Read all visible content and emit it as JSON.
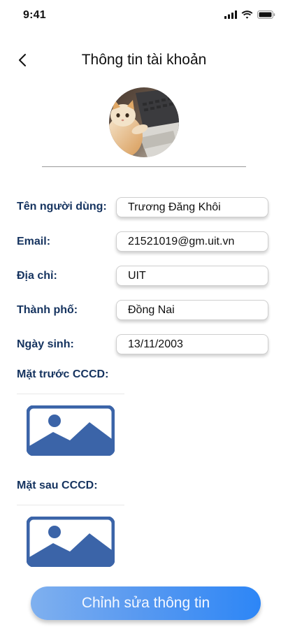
{
  "status_bar": {
    "time": "9:41",
    "icons": [
      "signal-icon",
      "wifi-icon",
      "battery-icon"
    ]
  },
  "header": {
    "title": "Thông tin tài khoản",
    "back_icon": "chevron-left-icon"
  },
  "profile": {
    "avatar": "cat-photo-avatar"
  },
  "form": {
    "username": {
      "label": "Tên người dùng:",
      "value": "Trương Đăng Khôi"
    },
    "email": {
      "label": "Email:",
      "value": "21521019@gm.uit.vn"
    },
    "address": {
      "label": "Địa chỉ:",
      "value": "UIT"
    },
    "city": {
      "label": "Thành phố:",
      "value": "Đồng Nai"
    },
    "birthday": {
      "label": "Ngày sinh:",
      "value": "13/11/2003"
    }
  },
  "id_card": {
    "front_label": "Mặt trước CCCD:",
    "back_label": "Mặt sau CCCD:",
    "placeholder_icon": "image-placeholder-icon"
  },
  "actions": {
    "edit_label": "Chỉnh sửa thông tin"
  },
  "colors": {
    "label": "#15335f",
    "image_icon": "#3b64a8",
    "button_start": "#7fb0ef",
    "button_end": "#2d86f6"
  }
}
